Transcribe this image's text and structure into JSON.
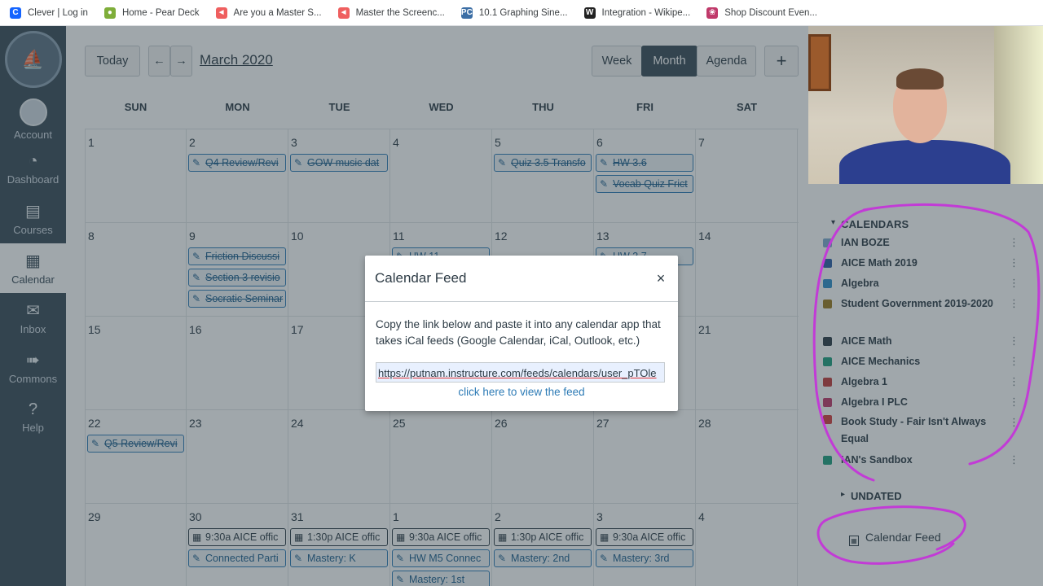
{
  "bookmarks": [
    {
      "label": "Clever | Log in",
      "icon": "clever-icon",
      "glyph": "C",
      "color": "#1464ff"
    },
    {
      "label": "Home - Pear Deck",
      "icon": "pear-icon",
      "glyph": "●",
      "color": "#7fae3a"
    },
    {
      "label": "Are you a Master S...",
      "icon": "screencastify-icon",
      "glyph": "◄",
      "color": "#ef5f5f"
    },
    {
      "label": "Master the Screenc...",
      "icon": "screencastify-icon",
      "glyph": "◄",
      "color": "#ef5f5f"
    },
    {
      "label": "10.1 Graphing Sine...",
      "icon": "pc-icon",
      "glyph": "PC",
      "color": "#3b6ea5"
    },
    {
      "label": "Integration - Wikipe...",
      "icon": "wikipedia-icon",
      "glyph": "W",
      "color": "#222222"
    },
    {
      "label": "Shop Discount Even...",
      "icon": "gift-icon",
      "glyph": "❀",
      "color": "#c0396a"
    }
  ],
  "nav": [
    {
      "label": "Account",
      "icon": "account-avatar"
    },
    {
      "label": "Dashboard",
      "icon": "dashboard-icon",
      "glyph": "◔"
    },
    {
      "label": "Courses",
      "icon": "courses-icon",
      "glyph": "▤"
    },
    {
      "label": "Calendar",
      "icon": "calendar-icon",
      "glyph": "▦"
    },
    {
      "label": "Inbox",
      "icon": "inbox-icon",
      "glyph": "✉"
    },
    {
      "label": "Commons",
      "icon": "commons-icon",
      "glyph": "➠"
    },
    {
      "label": "Help",
      "icon": "help-icon",
      "glyph": "?"
    }
  ],
  "header": {
    "today": "Today",
    "prev": "←",
    "next": "→",
    "month_title": "March 2020",
    "views": [
      "Week",
      "Month",
      "Agenda"
    ],
    "add": "+"
  },
  "calendar": {
    "weekdays": [
      "SUN",
      "MON",
      "TUE",
      "WED",
      "THU",
      "FRI",
      "SAT"
    ],
    "weeks": [
      [
        {
          "day": "1",
          "events": []
        },
        {
          "day": "2",
          "events": [
            {
              "t": "Q4 Review/Revi",
              "done": true
            }
          ]
        },
        {
          "day": "3",
          "events": [
            {
              "t": "GOW music dat",
              "done": true
            }
          ]
        },
        {
          "day": "4",
          "events": []
        },
        {
          "day": "5",
          "events": [
            {
              "t": "Quiz 3.5 Transfo",
              "done": true
            }
          ]
        },
        {
          "day": "6",
          "events": [
            {
              "t": "HW 3.6",
              "done": true
            },
            {
              "t": "Vocab Quiz Frict",
              "done": true
            }
          ]
        },
        {
          "day": "7",
          "events": []
        }
      ],
      [
        {
          "day": "8",
          "events": []
        },
        {
          "day": "9",
          "events": [
            {
              "t": "Friction Discussi",
              "done": true
            },
            {
              "t": "Section 3 revisio",
              "done": true
            },
            {
              "t": "Socratic Seminar",
              "done": true
            }
          ]
        },
        {
          "day": "10",
          "events": []
        },
        {
          "day": "11",
          "events": [
            {
              "t": "HW 11",
              "done": true
            }
          ]
        },
        {
          "day": "12",
          "events": []
        },
        {
          "day": "13",
          "events": [
            {
              "t": "HW 3.7",
              "done": true
            }
          ]
        },
        {
          "day": "14",
          "events": []
        }
      ],
      [
        {
          "day": "15",
          "events": []
        },
        {
          "day": "16",
          "events": []
        },
        {
          "day": "17",
          "events": []
        },
        {
          "day": "",
          "events": []
        },
        {
          "day": "",
          "events": []
        },
        {
          "day": "",
          "events": []
        },
        {
          "day": "21",
          "events": []
        }
      ],
      [
        {
          "day": "22",
          "events": [
            {
              "t": "Q5 Review/Revi",
              "done": true
            }
          ]
        },
        {
          "day": "23",
          "events": []
        },
        {
          "day": "24",
          "events": []
        },
        {
          "day": "25",
          "events": []
        },
        {
          "day": "26",
          "events": []
        },
        {
          "day": "27",
          "events": []
        },
        {
          "day": "28",
          "events": []
        }
      ],
      [
        {
          "day": "29",
          "events": []
        },
        {
          "day": "30",
          "events": [
            {
              "t": "9:30a AICE offic",
              "appt": true
            },
            {
              "t": "Connected Parti"
            }
          ]
        },
        {
          "day": "31",
          "events": [
            {
              "t": "1:30p AICE offic",
              "appt": true
            },
            {
              "t": "Mastery: K"
            }
          ]
        },
        {
          "day": "1",
          "events": [
            {
              "t": "9:30a AICE offic",
              "appt": true
            },
            {
              "t": "HW M5 Connec"
            },
            {
              "t": "Mastery: 1st"
            }
          ]
        },
        {
          "day": "2",
          "events": [
            {
              "t": "1:30p AICE offic",
              "appt": true
            },
            {
              "t": "Mastery: 2nd"
            }
          ]
        },
        {
          "day": "3",
          "events": [
            {
              "t": "9:30a AICE offic",
              "appt": true
            },
            {
              "t": "Mastery: 3rd"
            }
          ]
        },
        {
          "day": "4",
          "events": []
        }
      ]
    ]
  },
  "modal": {
    "title": "Calendar Feed",
    "close": "×",
    "body": "Copy the link below and paste it into any calendar app that takes iCal feeds (Google Calendar, iCal, Outlook, etc.)",
    "feed_url": "https://putnam.instructure.com/feeds/calendars/user_pTOle",
    "view_link": "click here to view the feed"
  },
  "sidebar": {
    "calendars_heading": "CALENDARS",
    "calendars": [
      {
        "name": "IAN BOZE",
        "color": "#7ea9cf"
      },
      {
        "name": "AICE Math 2019",
        "color": "#2a5ea7"
      },
      {
        "name": "Algebra",
        "color": "#2f8fcb"
      },
      {
        "name": "Student Government 2019-2020",
        "color": "#9b7b20"
      },
      {
        "name": "AICE Math",
        "color": "#2d3b45"
      },
      {
        "name": "AICE Mechanics",
        "color": "#1e9e7e"
      },
      {
        "name": "Algebra 1",
        "color": "#c23b3b"
      },
      {
        "name": "Algebra I PLC",
        "color": "#c0396a"
      },
      {
        "name": "Book Study - Fair Isn't Always Equal",
        "color": "#d33f3f"
      },
      {
        "name": "IAN's Sandbox",
        "color": "#1e9e7e"
      }
    ],
    "undated_heading": "UNDATED",
    "calendar_feed": "Calendar Feed"
  }
}
